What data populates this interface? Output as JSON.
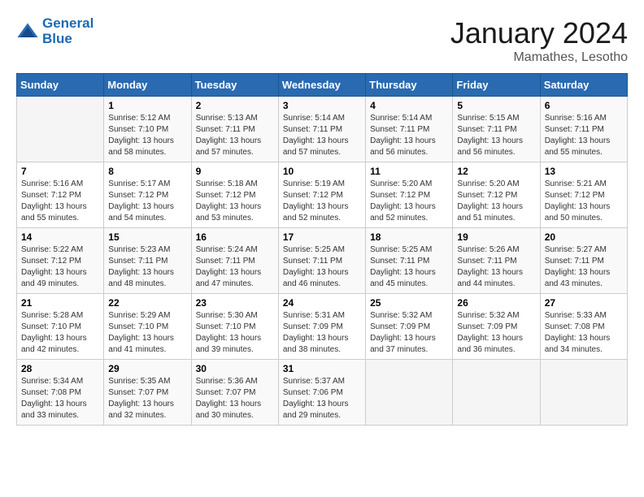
{
  "header": {
    "logo_line1": "General",
    "logo_line2": "Blue",
    "month": "January 2024",
    "location": "Mamathes, Lesotho"
  },
  "weekdays": [
    "Sunday",
    "Monday",
    "Tuesday",
    "Wednesday",
    "Thursday",
    "Friday",
    "Saturday"
  ],
  "weeks": [
    [
      {
        "day": "",
        "sunrise": "",
        "sunset": "",
        "daylight": ""
      },
      {
        "day": "1",
        "sunrise": "Sunrise: 5:12 AM",
        "sunset": "Sunset: 7:10 PM",
        "daylight": "Daylight: 13 hours and 58 minutes."
      },
      {
        "day": "2",
        "sunrise": "Sunrise: 5:13 AM",
        "sunset": "Sunset: 7:11 PM",
        "daylight": "Daylight: 13 hours and 57 minutes."
      },
      {
        "day": "3",
        "sunrise": "Sunrise: 5:14 AM",
        "sunset": "Sunset: 7:11 PM",
        "daylight": "Daylight: 13 hours and 57 minutes."
      },
      {
        "day": "4",
        "sunrise": "Sunrise: 5:14 AM",
        "sunset": "Sunset: 7:11 PM",
        "daylight": "Daylight: 13 hours and 56 minutes."
      },
      {
        "day": "5",
        "sunrise": "Sunrise: 5:15 AM",
        "sunset": "Sunset: 7:11 PM",
        "daylight": "Daylight: 13 hours and 56 minutes."
      },
      {
        "day": "6",
        "sunrise": "Sunrise: 5:16 AM",
        "sunset": "Sunset: 7:11 PM",
        "daylight": "Daylight: 13 hours and 55 minutes."
      }
    ],
    [
      {
        "day": "7",
        "sunrise": "Sunrise: 5:16 AM",
        "sunset": "Sunset: 7:12 PM",
        "daylight": "Daylight: 13 hours and 55 minutes."
      },
      {
        "day": "8",
        "sunrise": "Sunrise: 5:17 AM",
        "sunset": "Sunset: 7:12 PM",
        "daylight": "Daylight: 13 hours and 54 minutes."
      },
      {
        "day": "9",
        "sunrise": "Sunrise: 5:18 AM",
        "sunset": "Sunset: 7:12 PM",
        "daylight": "Daylight: 13 hours and 53 minutes."
      },
      {
        "day": "10",
        "sunrise": "Sunrise: 5:19 AM",
        "sunset": "Sunset: 7:12 PM",
        "daylight": "Daylight: 13 hours and 52 minutes."
      },
      {
        "day": "11",
        "sunrise": "Sunrise: 5:20 AM",
        "sunset": "Sunset: 7:12 PM",
        "daylight": "Daylight: 13 hours and 52 minutes."
      },
      {
        "day": "12",
        "sunrise": "Sunrise: 5:20 AM",
        "sunset": "Sunset: 7:12 PM",
        "daylight": "Daylight: 13 hours and 51 minutes."
      },
      {
        "day": "13",
        "sunrise": "Sunrise: 5:21 AM",
        "sunset": "Sunset: 7:12 PM",
        "daylight": "Daylight: 13 hours and 50 minutes."
      }
    ],
    [
      {
        "day": "14",
        "sunrise": "Sunrise: 5:22 AM",
        "sunset": "Sunset: 7:12 PM",
        "daylight": "Daylight: 13 hours and 49 minutes."
      },
      {
        "day": "15",
        "sunrise": "Sunrise: 5:23 AM",
        "sunset": "Sunset: 7:11 PM",
        "daylight": "Daylight: 13 hours and 48 minutes."
      },
      {
        "day": "16",
        "sunrise": "Sunrise: 5:24 AM",
        "sunset": "Sunset: 7:11 PM",
        "daylight": "Daylight: 13 hours and 47 minutes."
      },
      {
        "day": "17",
        "sunrise": "Sunrise: 5:25 AM",
        "sunset": "Sunset: 7:11 PM",
        "daylight": "Daylight: 13 hours and 46 minutes."
      },
      {
        "day": "18",
        "sunrise": "Sunrise: 5:25 AM",
        "sunset": "Sunset: 7:11 PM",
        "daylight": "Daylight: 13 hours and 45 minutes."
      },
      {
        "day": "19",
        "sunrise": "Sunrise: 5:26 AM",
        "sunset": "Sunset: 7:11 PM",
        "daylight": "Daylight: 13 hours and 44 minutes."
      },
      {
        "day": "20",
        "sunrise": "Sunrise: 5:27 AM",
        "sunset": "Sunset: 7:11 PM",
        "daylight": "Daylight: 13 hours and 43 minutes."
      }
    ],
    [
      {
        "day": "21",
        "sunrise": "Sunrise: 5:28 AM",
        "sunset": "Sunset: 7:10 PM",
        "daylight": "Daylight: 13 hours and 42 minutes."
      },
      {
        "day": "22",
        "sunrise": "Sunrise: 5:29 AM",
        "sunset": "Sunset: 7:10 PM",
        "daylight": "Daylight: 13 hours and 41 minutes."
      },
      {
        "day": "23",
        "sunrise": "Sunrise: 5:30 AM",
        "sunset": "Sunset: 7:10 PM",
        "daylight": "Daylight: 13 hours and 39 minutes."
      },
      {
        "day": "24",
        "sunrise": "Sunrise: 5:31 AM",
        "sunset": "Sunset: 7:09 PM",
        "daylight": "Daylight: 13 hours and 38 minutes."
      },
      {
        "day": "25",
        "sunrise": "Sunrise: 5:32 AM",
        "sunset": "Sunset: 7:09 PM",
        "daylight": "Daylight: 13 hours and 37 minutes."
      },
      {
        "day": "26",
        "sunrise": "Sunrise: 5:32 AM",
        "sunset": "Sunset: 7:09 PM",
        "daylight": "Daylight: 13 hours and 36 minutes."
      },
      {
        "day": "27",
        "sunrise": "Sunrise: 5:33 AM",
        "sunset": "Sunset: 7:08 PM",
        "daylight": "Daylight: 13 hours and 34 minutes."
      }
    ],
    [
      {
        "day": "28",
        "sunrise": "Sunrise: 5:34 AM",
        "sunset": "Sunset: 7:08 PM",
        "daylight": "Daylight: 13 hours and 33 minutes."
      },
      {
        "day": "29",
        "sunrise": "Sunrise: 5:35 AM",
        "sunset": "Sunset: 7:07 PM",
        "daylight": "Daylight: 13 hours and 32 minutes."
      },
      {
        "day": "30",
        "sunrise": "Sunrise: 5:36 AM",
        "sunset": "Sunset: 7:07 PM",
        "daylight": "Daylight: 13 hours and 30 minutes."
      },
      {
        "day": "31",
        "sunrise": "Sunrise: 5:37 AM",
        "sunset": "Sunset: 7:06 PM",
        "daylight": "Daylight: 13 hours and 29 minutes."
      },
      {
        "day": "",
        "sunrise": "",
        "sunset": "",
        "daylight": ""
      },
      {
        "day": "",
        "sunrise": "",
        "sunset": "",
        "daylight": ""
      },
      {
        "day": "",
        "sunrise": "",
        "sunset": "",
        "daylight": ""
      }
    ]
  ]
}
